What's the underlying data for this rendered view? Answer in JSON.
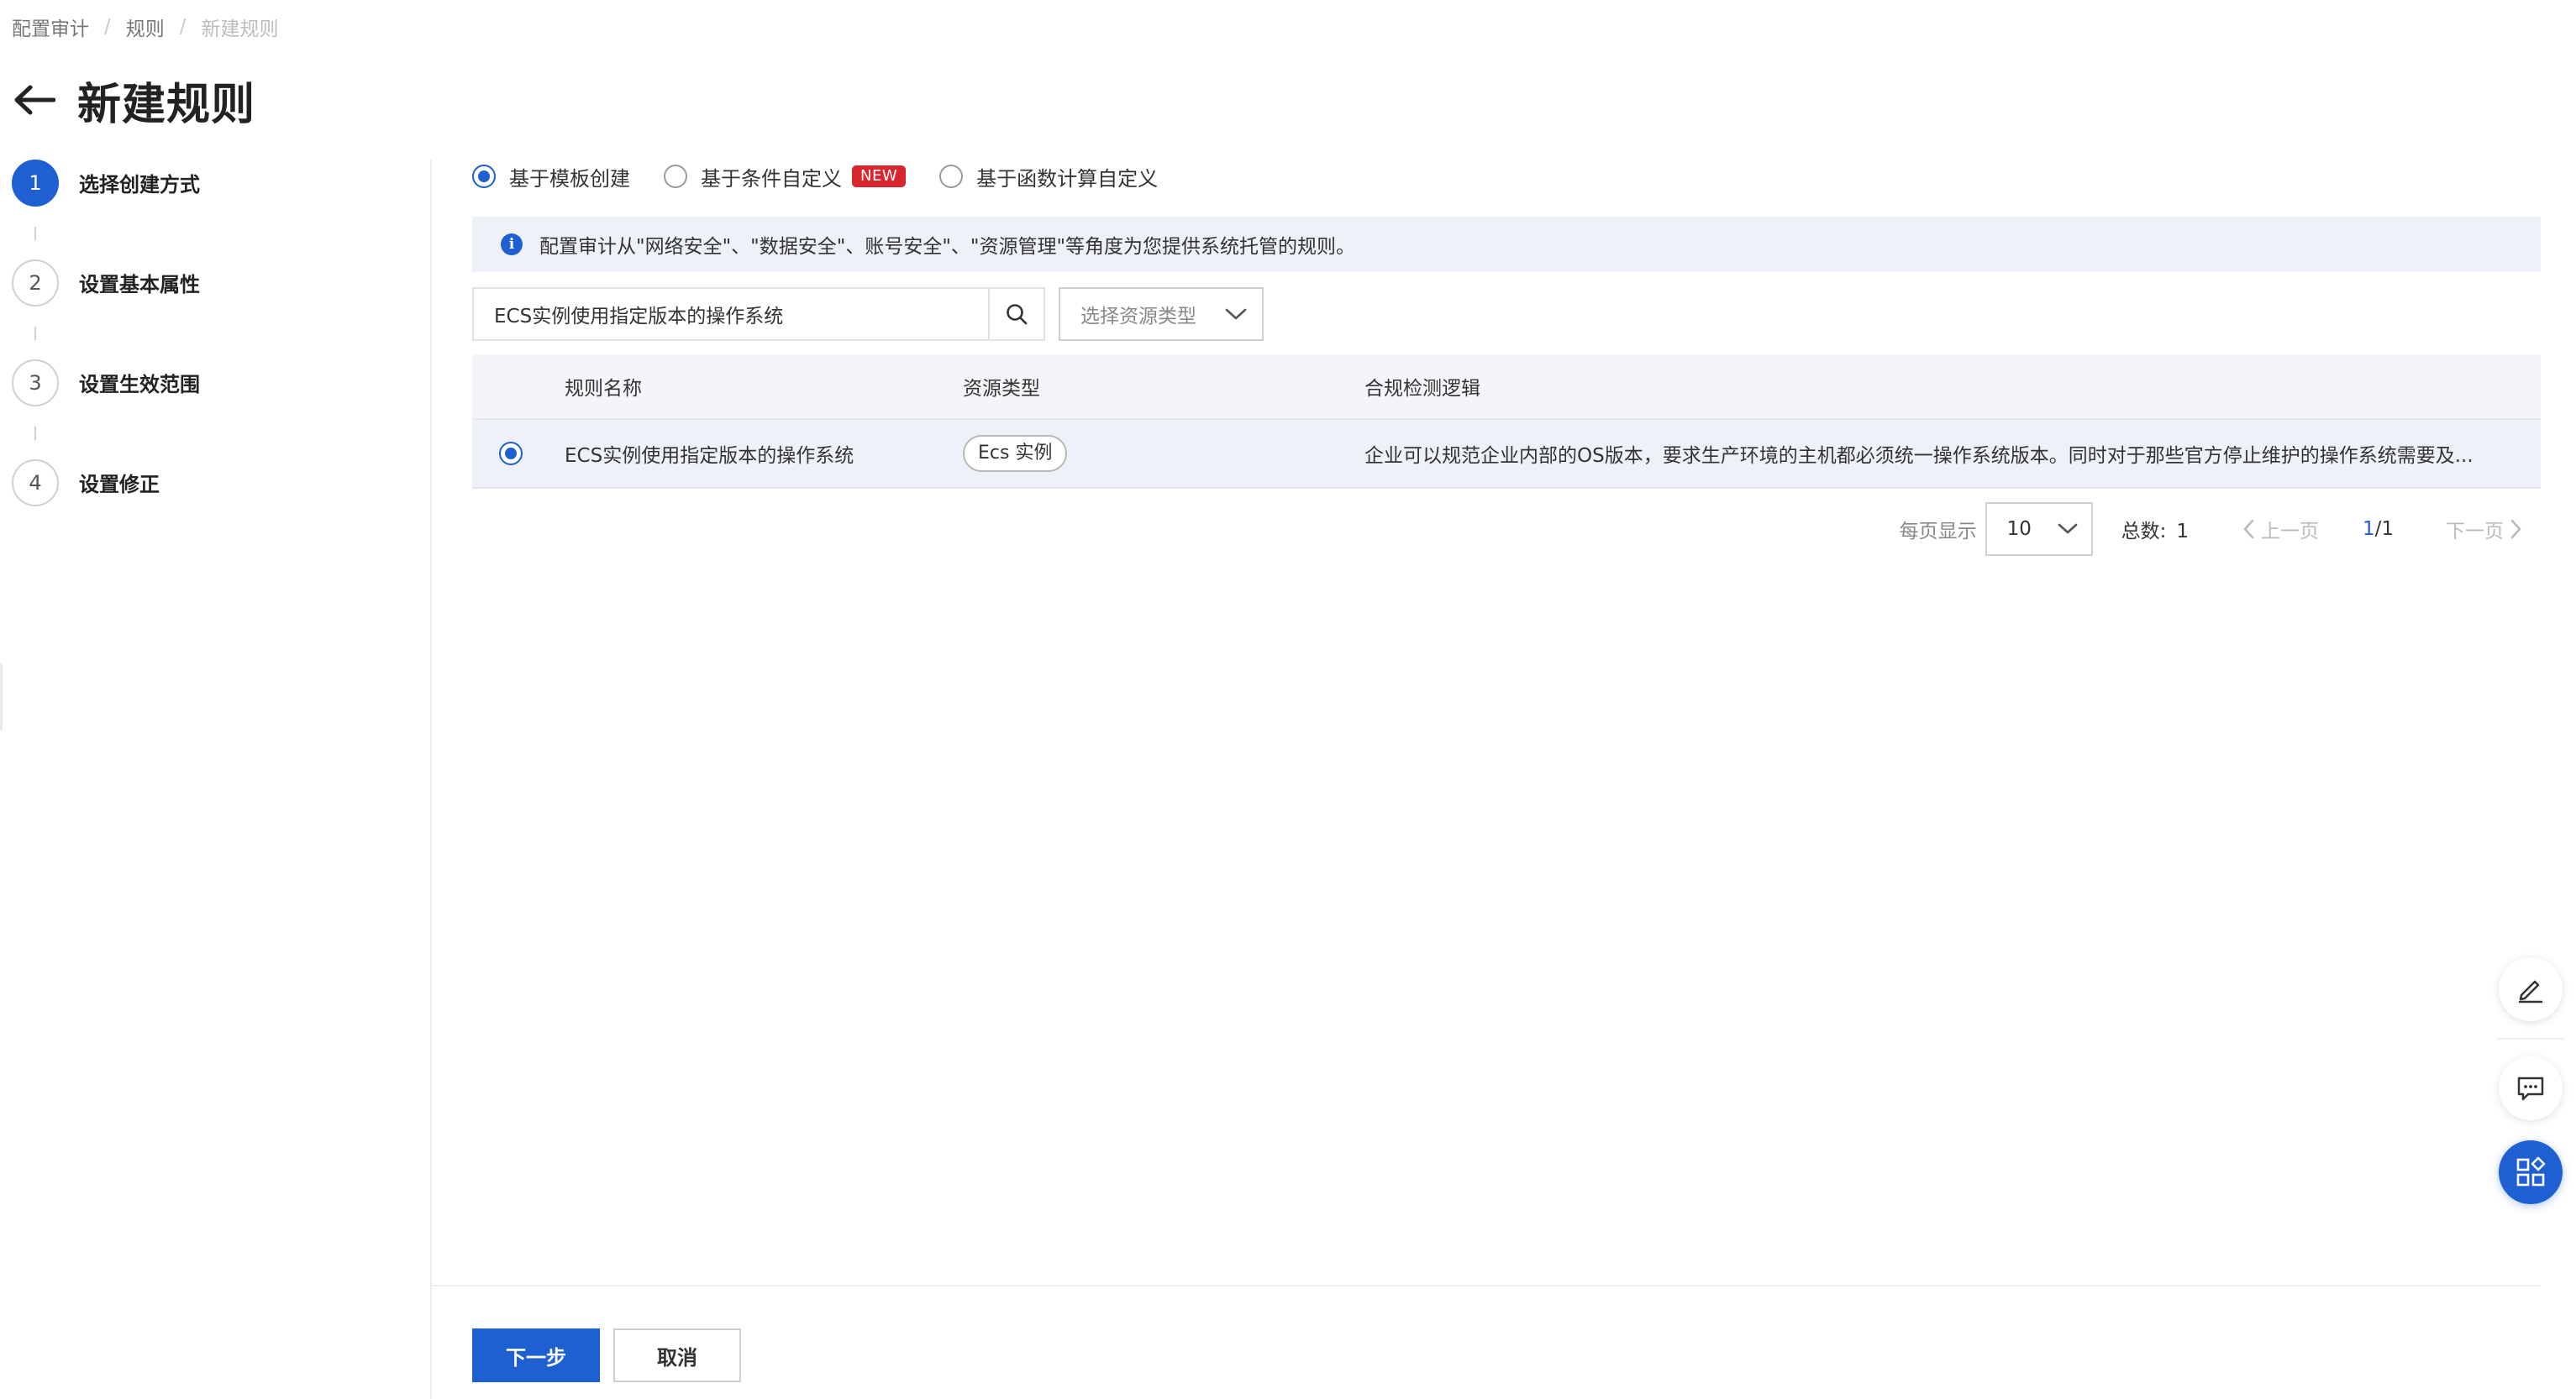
{
  "breadcrumb": {
    "item1": "配置审计",
    "item2": "规则",
    "item3": "新建规则",
    "separator": "/"
  },
  "page": {
    "title": "新建规则"
  },
  "steps": [
    {
      "number": "1",
      "label": "选择创建方式",
      "active": true
    },
    {
      "number": "2",
      "label": "设置基本属性",
      "active": false
    },
    {
      "number": "3",
      "label": "设置生效范围",
      "active": false
    },
    {
      "number": "4",
      "label": "设置修正",
      "active": false
    }
  ],
  "creation_modes": {
    "template": "基于模板创建",
    "condition": "基于条件自定义",
    "condition_badge": "NEW",
    "function": "基于函数计算自定义",
    "selected": "template"
  },
  "info": {
    "text": "配置审计从\"网络安全\"、\"数据安全\"、账号安全\"、\"资源管理\"等角度为您提供系统托管的规则。"
  },
  "search": {
    "value": "ECS实例使用指定版本的操作系统",
    "placeholder": "",
    "resource_type_placeholder": "选择资源类型"
  },
  "table": {
    "headers": {
      "name": "规则名称",
      "type": "资源类型",
      "logic": "合规检测逻辑"
    },
    "rows": [
      {
        "name": "ECS实例使用指定版本的操作系统",
        "type": "Ecs 实例",
        "logic": "企业可以规范企业内部的OS版本，要求生产环境的主机都必须统一操作系统版本。同时对于那些官方停止维护的操作系统需要及...",
        "selected": true
      }
    ]
  },
  "pagination": {
    "page_size_label": "每页显示",
    "page_size": "10",
    "total_label": "总数:",
    "total": "1",
    "prev": "上一页",
    "current_page": "1",
    "page_count": "/1",
    "next": "下一页"
  },
  "footer": {
    "next": "下一步",
    "cancel": "取消"
  },
  "icons": [
    "back-arrow-icon",
    "info-icon",
    "search-icon",
    "chevron-down-icon",
    "chevron-left-icon",
    "chevron-right-icon",
    "edit-icon",
    "chat-icon",
    "apps-icon"
  ],
  "colors": {
    "primary": "#1e5fd1",
    "badge": "#d9262c",
    "banner_bg": "#eef1f7",
    "header_bg": "#f3f5f8"
  }
}
